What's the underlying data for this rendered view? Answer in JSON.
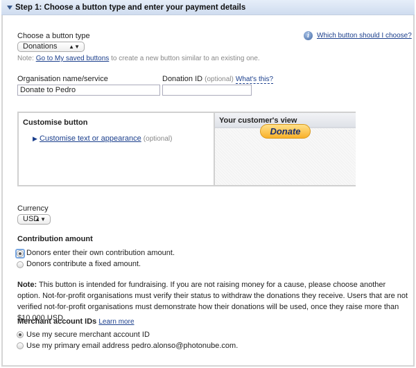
{
  "header": {
    "title": "Step 1: Choose a button type and enter your payment details"
  },
  "button_type": {
    "label": "Choose a button type",
    "value": "Donations",
    "help_link": "Which button should I choose?",
    "note_prefix": "Note:",
    "note_link": "Go to My saved buttons",
    "note_suffix": "to create a new button similar to an existing one."
  },
  "org": {
    "label": "Organisation name/service",
    "value": "Donate to Pedro"
  },
  "donation_id": {
    "label": "Donation ID",
    "optional": "(optional)",
    "help": "What's this?",
    "value": ""
  },
  "customise": {
    "title": "Customise button",
    "link": "Customise text or appearance",
    "optional": "(optional)",
    "preview_title": "Your customer's view",
    "donate_button": "Donate"
  },
  "currency": {
    "label": "Currency",
    "value": "USD"
  },
  "contribution": {
    "title": "Contribution amount",
    "options": [
      "Donors enter their own contribution amount.",
      "Donors contribute a fixed amount."
    ],
    "selected": 0
  },
  "note": {
    "label": "Note:",
    "text": "This button is intended for fundraising. If you are not raising money for a cause, please choose another option. Not-for-profit organisations must verify their status to withdraw the donations they receive. Users that are not verified not-for-profit organisations must demonstrate how their donations will be used, once they raise more than $10,000 USD."
  },
  "merchant": {
    "title": "Merchant account IDs",
    "learn_more": "Learn more",
    "options": [
      "Use my secure merchant account ID",
      "Use my primary email address pedro.alonso@photonube.com."
    ],
    "selected": 0
  }
}
